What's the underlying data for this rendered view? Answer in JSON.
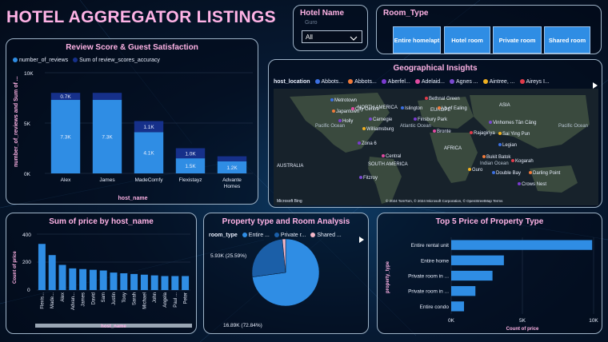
{
  "title": "HOTEL AGGREGATOR LISTINGS",
  "colors": {
    "accent_pink": "#ffb3e6",
    "bar_light": "#2f8de4",
    "bar_dark": "#16308a",
    "bg": "#071a33"
  },
  "hotel_slicer": {
    "label": "Hotel Name",
    "placeholder": "Guro",
    "selected": "All"
  },
  "room_slicer": {
    "label": "Room_Type",
    "options": [
      "Entire home/apt",
      "Hotel room",
      "Private room",
      "Shared room"
    ]
  },
  "review_chart": {
    "title": "Review Score & Guest Satisfaction",
    "legend": [
      "number_of_reviews",
      "Sum of review_scores_accuracy"
    ],
    "xlabel": "host_name",
    "ylabel": "number_of_reviews and Sum of ...",
    "yticks": [
      "10K",
      "5K",
      "0K"
    ]
  },
  "geo": {
    "title": "Geographical Insights",
    "legend_label": "host_location",
    "legend_items": [
      "Abbots...",
      "Abbots...",
      "Aberfel...",
      "Adelaid...",
      "Agnes ...",
      "Aintree, ...",
      "Aireys I..."
    ],
    "legend_colors": [
      "#3b6fe0",
      "#f07a3a",
      "#7a3bd0",
      "#e04aa0",
      "#7a4ad0",
      "#f0b020",
      "#e03a4a"
    ],
    "map_labels": {
      "north_america": "NORTH AMERICA",
      "europe": "EUROPE",
      "asia": "ASIA",
      "africa": "AFRICA",
      "south_america": "SOUTH AMERICA",
      "australia": "AUSTRALIA",
      "pacific_left": "Pacific Ocean",
      "atlantic": "Atlantic Ocean",
      "indian": "Indian Ocean",
      "pacific_right": "Pacific Ocean"
    },
    "places": [
      "Metrotown",
      "Japantown",
      "Holly",
      "City Centre",
      "Carnegie",
      "Williamsburg",
      "Bethnal Green",
      "Islington",
      "Lb of Ealing",
      "Finsbury Park",
      "Bronte",
      "Vinhomes Tân Cảng",
      "Sai Ying Pun",
      "Rajagiriya",
      "Legian",
      "Bukit Batok",
      "Zona 6",
      "Central",
      "Fitzroy",
      "Guro",
      "Kogarah",
      "Double Bay",
      "Darling Point",
      "Crows Nest"
    ],
    "credit": "© 2024 TomTom, © 2024 Microsoft Corporation, © OpenStreetMap  Terms",
    "bing": "Microsoft Bing"
  },
  "price_chart": {
    "title": "Sum of price by host_name",
    "xlabel": "host_name",
    "ylabel": "Count of price",
    "yticks": [
      "400",
      "200",
      "0"
    ]
  },
  "pie_chart": {
    "title": "Property type and Room Analysis",
    "legend_label": "room_type",
    "legend_items": [
      "Entire ...",
      "Private r...",
      "Shared ..."
    ],
    "legend_colors": [
      "#2f8de4",
      "#1b5fa8",
      "#f5b8c8"
    ],
    "label_small": "5.93K (25.59%)",
    "label_big": "16.89K (72.84%)"
  },
  "top5_chart": {
    "title": "Top 5 Price of Property Type",
    "xlabel": "Count of price",
    "ylabel": "property_type",
    "xticks": [
      "0K",
      "5K",
      "10K"
    ]
  },
  "chart_data": [
    {
      "type": "bar",
      "stacked": true,
      "categories": [
        "Alex",
        "James",
        "MadeComfy",
        "Flexistayz",
        "Advante Homes"
      ],
      "series": [
        {
          "name": "number_of_reviews",
          "values": [
            7300,
            7300,
            4100,
            1500,
            1200
          ],
          "labels": [
            "7.3K",
            "7.3K",
            "4.1K",
            "1.5K",
            "1.2K"
          ]
        },
        {
          "name": "Sum of review_scores_accuracy",
          "values": [
            700,
            700,
            1100,
            1000,
            500
          ],
          "labels": [
            "0.7K",
            "",
            "1.1K",
            "1.0K",
            ""
          ]
        }
      ],
      "ylim": [
        0,
        10000
      ]
    },
    {
      "type": "bar",
      "categories": [
        "Flexis...",
        "Made...",
        "Alex",
        "Advan...",
        "James",
        "David",
        "Sam",
        "Justin",
        "Tony",
        "Sarah",
        "Michael",
        "John",
        "Angela",
        "Paul ...",
        "Peter"
      ],
      "values": [
        330,
        250,
        180,
        155,
        150,
        145,
        140,
        125,
        120,
        115,
        110,
        105,
        100,
        100,
        100
      ],
      "ylim": [
        0,
        400
      ]
    },
    {
      "type": "pie",
      "categories": [
        "Entire home/apt",
        "Private room",
        "Shared room"
      ],
      "values": [
        16890,
        5930,
        365
      ],
      "labels": [
        "16.89K (72.84%)",
        "5.93K (25.59%)",
        ""
      ]
    },
    {
      "type": "bar",
      "orientation": "horizontal",
      "categories": [
        "Entire rental unit",
        "Entire home",
        "Private room in ...",
        "Private room in ...",
        "Entire condo"
      ],
      "values": [
        9900,
        3700,
        2900,
        1700,
        900
      ],
      "xlim": [
        0,
        10000
      ]
    }
  ]
}
